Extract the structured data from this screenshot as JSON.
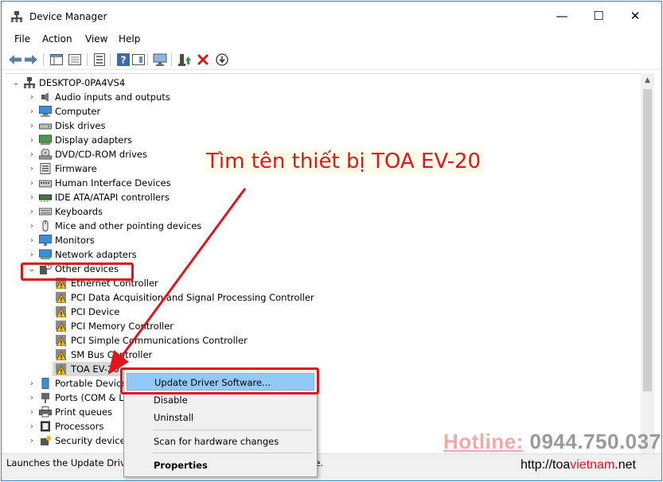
{
  "window": {
    "title": "Device Manager",
    "controls": {
      "minimize": "—",
      "maximize": "☐",
      "close": "✕"
    }
  },
  "menu": [
    "File",
    "Action",
    "View",
    "Help"
  ],
  "toolbar": {
    "icons": [
      "back-icon",
      "forward-icon",
      "show-hide-tree-icon",
      "properties-icon",
      "help-icon",
      "view-icon",
      "monitor-icon",
      "update-driver-icon",
      "uninstall-icon",
      "install-icon"
    ]
  },
  "tree": {
    "root": "DESKTOP-0PA4VS4",
    "categories": [
      "Audio inputs and outputs",
      "Computer",
      "Disk drives",
      "Display adapters",
      "DVD/CD-ROM drives",
      "Firmware",
      "Human Interface Devices",
      "IDE ATA/ATAPI controllers",
      "Keyboards",
      "Mice and other pointing devices",
      "Monitors",
      "Network adapters"
    ],
    "other_devices": {
      "label": "Other devices",
      "children": [
        "Ethernet Controller",
        "PCI Data Acquisition and Signal Processing Controller",
        "PCI Device",
        "PCI Memory Controller",
        "PCI Simple Communications Controller",
        "SM Bus Controller",
        "TOA EV-20"
      ]
    },
    "after": [
      "Portable Devices",
      "Ports (COM & LPT)",
      "Print queues",
      "Processors",
      "Security devices"
    ]
  },
  "context_menu": {
    "items": [
      {
        "label": "Update Driver Software...",
        "active": true
      },
      {
        "label": "Disable"
      },
      {
        "label": "Uninstall"
      },
      {
        "label": "Scan for hardware changes"
      },
      {
        "label": "Properties",
        "bold": true
      }
    ]
  },
  "status": {
    "text": "Launches the Update Driver Software Wizard for the selected device."
  },
  "annotation": {
    "text": "Tìm tên thiết bị TOA EV-20",
    "color": "#e0151c"
  },
  "watermark": {
    "hotline_label": "Hotline:",
    "hotline_number": "0944.750.037",
    "site_prefix": "http://toa",
    "site_accent": "vietnam",
    "site_suffix": ".net"
  }
}
